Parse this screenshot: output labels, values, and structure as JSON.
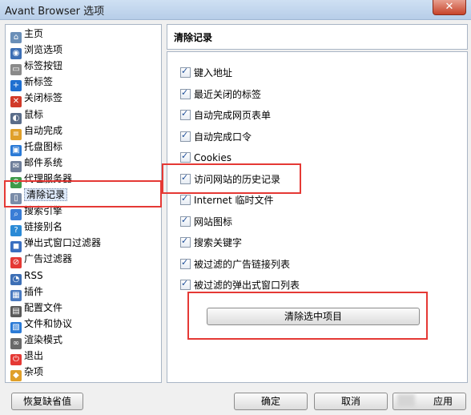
{
  "window": {
    "title": "Avant Browser 选项",
    "close_symbol": "✕"
  },
  "tree": {
    "items": [
      {
        "label": "主页",
        "icon": "home-icon",
        "color": "#6a8fb8",
        "glyph": "⌂"
      },
      {
        "label": "浏览选项",
        "icon": "browse-icon",
        "color": "#3d6fb5",
        "glyph": "◉"
      },
      {
        "label": "标签按钮",
        "icon": "tab-button-icon",
        "color": "#8a8a8a",
        "glyph": "▭"
      },
      {
        "label": "新标签",
        "icon": "plus-icon",
        "color": "#1f6fd0",
        "glyph": "+"
      },
      {
        "label": "关闭标签",
        "icon": "close-tab-icon",
        "color": "#d13a2a",
        "glyph": "✕"
      },
      {
        "label": "鼠标",
        "icon": "mouse-icon",
        "color": "#5a6d8a",
        "glyph": "◐"
      },
      {
        "label": "自动完成",
        "icon": "autocomplete-icon",
        "color": "#e0a02a",
        "glyph": "≡"
      },
      {
        "label": "托盘图标",
        "icon": "tray-icon",
        "color": "#2a7ad6",
        "glyph": "▣"
      },
      {
        "label": "邮件系统",
        "icon": "mail-icon",
        "color": "#6f7f9a",
        "glyph": "✉"
      },
      {
        "label": "代理服务器",
        "icon": "proxy-icon",
        "color": "#3f9a4a",
        "glyph": "⚙"
      },
      {
        "label": "清除记录",
        "icon": "trash-icon",
        "color": "#7a8ca8",
        "glyph": "▯"
      },
      {
        "label": "搜索引擎",
        "icon": "search-icon",
        "color": "#3a7dd6",
        "glyph": "⌕"
      },
      {
        "label": "链接别名",
        "icon": "link-alias-icon",
        "color": "#2a8ad6",
        "glyph": "?"
      },
      {
        "label": "弹出式窗口过滤器",
        "icon": "popup-filter-icon",
        "color": "#3a6fc0",
        "glyph": "◼"
      },
      {
        "label": "广告过滤器",
        "icon": "ad-filter-icon",
        "color": "#e53935",
        "glyph": "⊘"
      },
      {
        "label": "RSS",
        "icon": "rss-icon",
        "color": "#3d6fb5",
        "glyph": "◔"
      },
      {
        "label": "插件",
        "icon": "plugin-icon",
        "color": "#4a7ac0",
        "glyph": "▦"
      },
      {
        "label": "配置文件",
        "icon": "config-file-icon",
        "color": "#5a5a5a",
        "glyph": "▤"
      },
      {
        "label": "文件和协议",
        "icon": "file-protocol-icon",
        "color": "#2a7ad6",
        "glyph": "▧"
      },
      {
        "label": "渲染模式",
        "icon": "render-mode-icon",
        "color": "#6a6a6a",
        "glyph": "∞"
      },
      {
        "label": "退出",
        "icon": "power-icon",
        "color": "#e53935",
        "glyph": "⏻"
      },
      {
        "label": "杂项",
        "icon": "misc-icon",
        "color": "#e0a02a",
        "glyph": "◆"
      }
    ],
    "selected_index": 10
  },
  "right": {
    "header_title": "清除记录",
    "checkboxes": [
      {
        "label": "键入地址",
        "checked": true
      },
      {
        "label": "最近关闭的标签",
        "checked": true
      },
      {
        "label": "自动完成网页表单",
        "checked": true
      },
      {
        "label": "自动完成口令",
        "checked": true
      },
      {
        "label": "Cookies",
        "checked": true
      },
      {
        "label": "访问网站的历史记录",
        "checked": true
      },
      {
        "label": "Internet 临时文件",
        "checked": true
      },
      {
        "label": "网站图标",
        "checked": true
      },
      {
        "label": "搜索关键字",
        "checked": true
      },
      {
        "label": "被过滤的广告链接列表",
        "checked": true
      },
      {
        "label": "被过滤的弹出式窗口列表",
        "checked": true
      }
    ],
    "clear_selected_label": "清除选中项目"
  },
  "footer": {
    "restore_defaults_label": "恢复缺省值",
    "ok_label": "确定",
    "cancel_label": "取消",
    "apply_label": "应用"
  },
  "annotation_color": "#e53935"
}
